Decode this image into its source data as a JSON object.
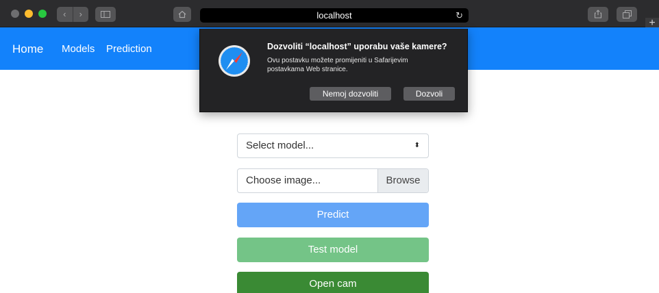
{
  "browser": {
    "address": "localhost",
    "reload_icon": "↻",
    "back_icon": "‹",
    "forward_icon": "›",
    "newtab_icon": "+"
  },
  "navbar": {
    "brand": "Home",
    "links": [
      "Models",
      "Prediction"
    ],
    "color": "#1382fb"
  },
  "permission_popup": {
    "title": "Dozvoliti “localhost” uporabu vaše kamere?",
    "text": "Ovu postavku možete promijeniti u Safarijevim postavkama Web stranice.",
    "deny_label": "Nemoj dozvoliti",
    "allow_label": "Dozvoli"
  },
  "form": {
    "select_model": "Select model...",
    "select_arrows": "⬍",
    "file_placeholder": "Choose image...",
    "browse_label": "Browse",
    "predict_label": "Predict",
    "test_label": "Test model",
    "open_cam_label": "Open cam"
  },
  "colors": {
    "predict": "#64a5f7",
    "test": "#74c487",
    "open_cam": "#3a8a34",
    "toolbar": "#2c2c2e"
  }
}
